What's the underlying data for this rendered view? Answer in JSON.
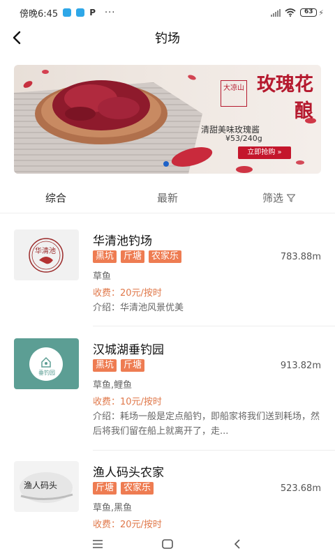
{
  "status_bar": {
    "time": "傍晚6:45",
    "battery": "63",
    "more": "···"
  },
  "nav": {
    "title": "钓场"
  },
  "banner": {
    "badge": "大凉山",
    "title_line1": "玫瑰花",
    "title_line2": "酿",
    "subtitle": "清甜美味玫瑰酱",
    "price": "¥53/240g",
    "button_label": "立即抢购 »"
  },
  "tabs": [
    {
      "label": "综合",
      "active": true
    },
    {
      "label": "最新",
      "active": false
    },
    {
      "label": "筛选",
      "active": false
    }
  ],
  "items": [
    {
      "name": "华清池钓场",
      "tags": [
        "黑坑",
        "斤塘",
        "农家乐"
      ],
      "distance": "783.88m",
      "fish": "草鱼",
      "fee": "收费：20元/按时",
      "intro": "介绍：华清池风景优美",
      "logo_text": "华清池"
    },
    {
      "name": "汉城湖垂钓园",
      "tags": [
        "黑坑",
        "斤塘"
      ],
      "distance": "913.82m",
      "fish": "草鱼,鲤鱼",
      "fee": "收费：10元/按时",
      "intro": "介绍：耗场一般是定点船钓，即船家将我们送到耗场，然后将我们留在船上就离开了，走...",
      "logo_text": "垂钓园"
    },
    {
      "name": "渔人码头农家",
      "tags": [
        "斤塘",
        "农家乐"
      ],
      "distance": "523.68m",
      "fish": "草鱼,黑鱼",
      "fee": "收费：20元/按时",
      "intro": "",
      "logo_text": "渔人码头"
    }
  ],
  "colors": {
    "tag": "#ee7c52",
    "fee": "#e0784a",
    "banner_red": "#c4162c"
  }
}
